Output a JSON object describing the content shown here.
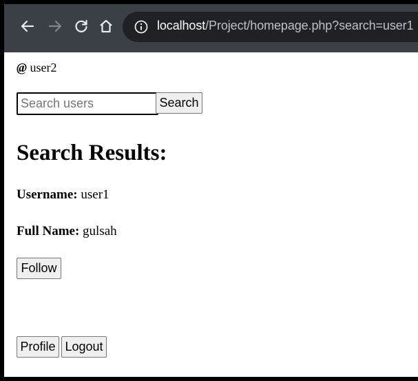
{
  "browser": {
    "back_icon": "arrow-left-icon",
    "forward_icon": "arrow-right-icon",
    "reload_icon": "reload-icon",
    "home_icon": "home-icon",
    "site_info_icon": "info-icon",
    "url_host": "localhost",
    "url_path": "/Project/homepage.php?search=user1"
  },
  "page": {
    "current_user_prefix": "@",
    "current_user": "user2",
    "search": {
      "placeholder": "Search users",
      "value": "",
      "button_label": "Search"
    },
    "results_heading": "Search Results:",
    "result": {
      "username_label": "Username:",
      "username_value": "user1",
      "fullname_label": "Full Name:",
      "fullname_value": "gulsah"
    },
    "follow_label": "Follow",
    "profile_label": "Profile",
    "logout_label": "Logout"
  },
  "colors": {
    "toolbar": "#3b3f46",
    "omnibox": "#202124",
    "button_bg": "#efefef"
  }
}
